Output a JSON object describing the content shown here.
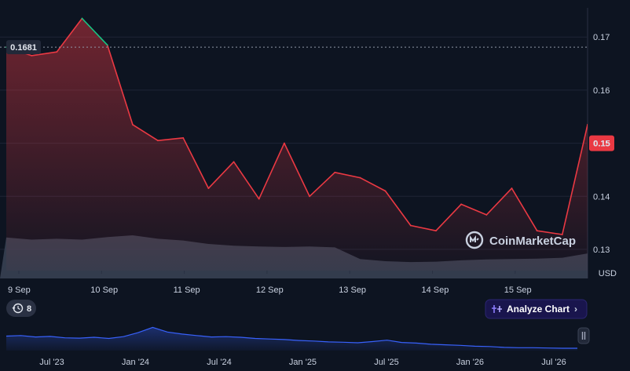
{
  "chart_data": {
    "type": "line",
    "x": [
      "9 Sep",
      "9 Sep",
      "9 Sep",
      "9 Sep",
      "10 Sep",
      "10 Sep",
      "10 Sep",
      "11 Sep",
      "11 Sep",
      "11 Sep",
      "11 Sep",
      "12 Sep",
      "12 Sep",
      "12 Sep",
      "13 Sep",
      "13 Sep",
      "13 Sep",
      "14 Sep",
      "14 Sep",
      "14 Sep",
      "15 Sep",
      "15 Sep",
      "15 Sep",
      "15 Sep"
    ],
    "xticks": [
      "9 Sep",
      "10 Sep",
      "11 Sep",
      "12 Sep",
      "13 Sep",
      "14 Sep",
      "15 Sep"
    ],
    "yticks": [
      0.17,
      0.16,
      0.15,
      0.14,
      0.13
    ],
    "ylim": [
      0.126,
      0.1755
    ],
    "y_unit": "USD",
    "reference_price": 0.1681,
    "current_price": 0.15,
    "current_price_label": "0.15",
    "reference_label": "0.1681",
    "series": [
      {
        "values": [
          0.1681,
          0.1665,
          0.1672,
          0.1735,
          0.1685,
          0.1535,
          0.1505,
          0.151,
          0.1415,
          0.1465,
          0.1395,
          0.15,
          0.14,
          0.1445,
          0.1435,
          0.141,
          0.1345,
          0.1335,
          0.1385,
          0.1365,
          0.1415,
          0.1335,
          0.1328,
          0.1535
        ]
      }
    ],
    "volume_relative": [
      0.95,
      0.9,
      0.92,
      0.9,
      0.96,
      1.0,
      0.92,
      0.88,
      0.8,
      0.76,
      0.74,
      0.73,
      0.74,
      0.72,
      0.45,
      0.4,
      0.38,
      0.39,
      0.42,
      0.44,
      0.45,
      0.46,
      0.48,
      0.58
    ]
  },
  "navigator": {
    "labels": [
      "Jul '23",
      "Jan '24",
      "Jul '24",
      "Jan '25",
      "Jul '25",
      "Jan '26",
      "Jul '26"
    ],
    "history": [
      0.5,
      0.52,
      0.47,
      0.49,
      0.44,
      0.43,
      0.46,
      0.42,
      0.48,
      0.62,
      0.8,
      0.64,
      0.57,
      0.52,
      0.47,
      0.48,
      0.46,
      0.42,
      0.4,
      0.38,
      0.35,
      0.33,
      0.3,
      0.29,
      0.27,
      0.31,
      0.36,
      0.28,
      0.26,
      0.22,
      0.2,
      0.18,
      0.15,
      0.14,
      0.11,
      0.1,
      0.1,
      0.09,
      0.08,
      0.08
    ]
  },
  "events_badge": "8",
  "analyze_button": {
    "label": "Analyze Chart",
    "chevron": "›"
  },
  "watermark": "CoinMarketCap",
  "colors": {
    "background": "#0d1421",
    "line_down": "#ea3943",
    "line_up": "#16c784",
    "volume": "#3b4355",
    "navigator_line": "#3861fb",
    "accent": "#3861fb"
  },
  "icons": {
    "events": "clock-history-icon",
    "analyze": "sparkle-icon",
    "scroll": "pause-handle-icon"
  }
}
